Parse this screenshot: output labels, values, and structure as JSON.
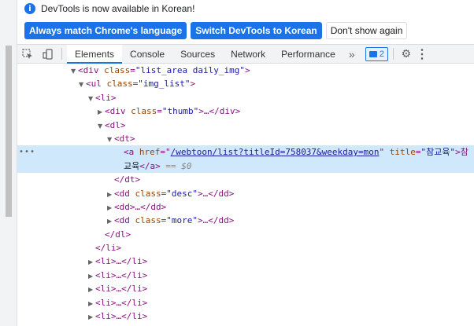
{
  "infobar": {
    "icon": "info-icon",
    "message": "DevTools is now available in Korean!",
    "buttons": {
      "match_language": "Always match Chrome's language",
      "switch_korean": "Switch DevTools to Korean",
      "dont_show": "Don't show again"
    }
  },
  "tabs": {
    "items": [
      "Elements",
      "Console",
      "Sources",
      "Network",
      "Performance"
    ],
    "active": "Elements",
    "more": "»",
    "issues_count": "2"
  },
  "dom": {
    "r1": {
      "tag_open": "<div ",
      "attr": "class",
      "val": "\"list_area daily_img\"",
      "close": ">"
    },
    "r2": {
      "tag_open": "<ul ",
      "attr": "class",
      "val": "\"img_list\"",
      "close": ">"
    },
    "r3": {
      "text": "<li>"
    },
    "r4": {
      "tag_open": "<div ",
      "attr": "class",
      "val": "\"thumb\"",
      "close": ">…</div>"
    },
    "r5": {
      "text": "<dl>"
    },
    "r6": {
      "text": "<dt>"
    },
    "r7": {
      "dots": "•••",
      "tag_open": "<a ",
      "href_attr": "href",
      "href_val": "/webtoon/list?titleId=758037&weekday=mon",
      "title_attr": "title",
      "title_val": "\"참교육\"",
      "close": ">참"
    },
    "r8": {
      "text_content": "교육",
      "close_tag": "</a>",
      "eq": " == ",
      "var": "$0"
    },
    "r9": {
      "text": "</dt>"
    },
    "r10": {
      "tag_open": "<dd ",
      "attr": "class",
      "val": "\"desc\"",
      "close": ">…</dd>"
    },
    "r11": {
      "text": "<dd>…</dd>"
    },
    "r12": {
      "tag_open": "<dd ",
      "attr": "class",
      "val": "\"more\"",
      "close": ">…</dd>"
    },
    "r13": {
      "text": "</dl>"
    },
    "r14": {
      "text": "</li>"
    },
    "collapsed_li": "<li>…</li>"
  }
}
